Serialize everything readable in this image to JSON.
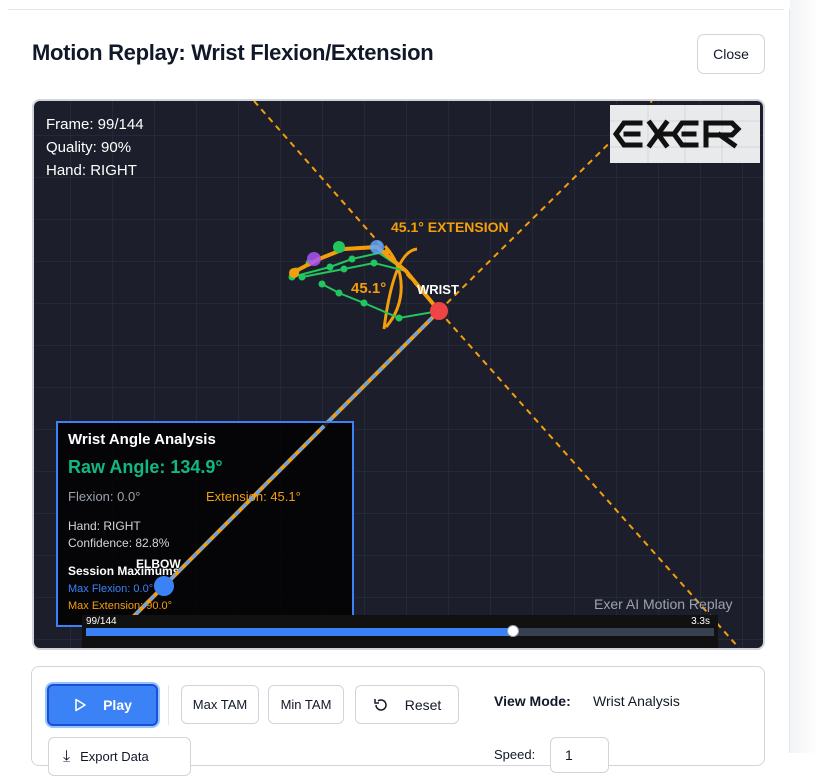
{
  "dialog": {
    "title": "Motion Replay: Wrist Flexion/Extension",
    "close_label": "Close"
  },
  "viewer": {
    "frame_text": "Frame: 99/144",
    "quality_text": "Quality: 90%",
    "hand_text": "Hand: RIGHT",
    "logo_text": "EXER",
    "extension_label": "45.1° EXTENSION",
    "angle_label": "45.1°",
    "wrist_label": "WRIST",
    "elbow_label": "ELBOW",
    "watermark": "Exer AI Motion Replay",
    "timeline": {
      "frame_label": "99/144",
      "time_label": "3.3s",
      "progress": 0.68
    }
  },
  "analysis": {
    "title": "Wrist Angle Analysis",
    "raw_angle": "Raw Angle: 134.9°",
    "flexion": "Flexion: 0.0°",
    "extension": "Extension: 45.1°",
    "hand": "Hand: RIGHT",
    "confidence": "Confidence: 82.8%",
    "session_title": "Session Maximums",
    "max_flexion": "Max Flexion: 0.0°",
    "max_extension": "Max Extension: 90.0°"
  },
  "controls": {
    "play_label": "Play",
    "max_tam_label": "Max TAM",
    "min_tam_label": "Min TAM",
    "reset_label": "Reset",
    "view_mode_label": "View Mode:",
    "view_mode_value": "Wrist Analysis",
    "export_label": "Export Data",
    "speed_label": "Speed:",
    "speed_value": "1"
  },
  "colors": {
    "accent_blue": "#3b82f6",
    "extension_orange": "#f59e0b",
    "raw_angle_green": "#10b981",
    "wrist_red": "#ef4444",
    "hand_green": "#22c55e"
  }
}
